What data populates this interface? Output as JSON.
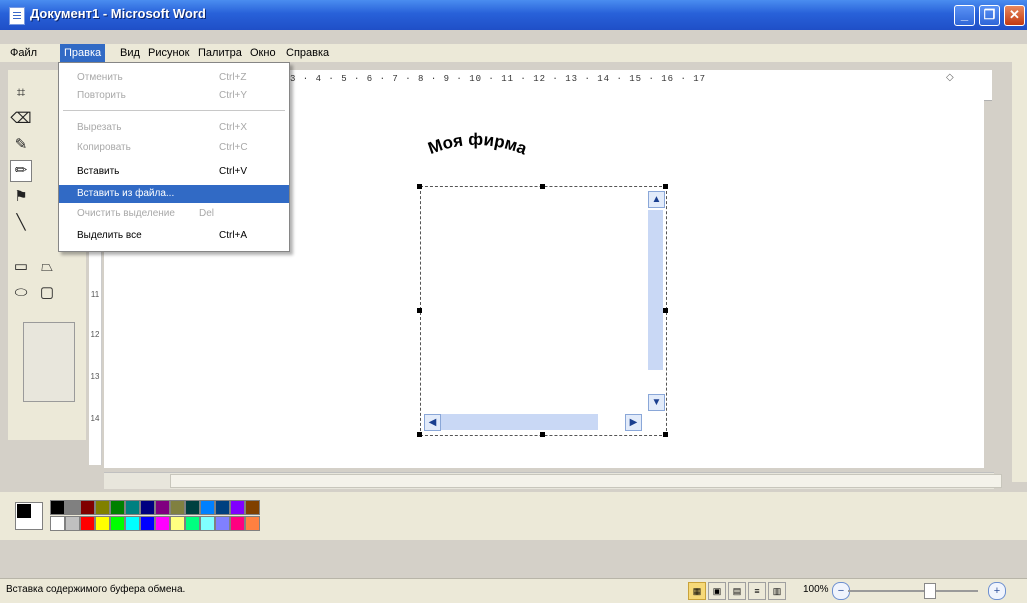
{
  "window": {
    "title": "Документ1 - Microsoft Word",
    "minimize_glyph": "_",
    "restore_glyph": "❐",
    "close_glyph": "✕"
  },
  "menubar": {
    "items": [
      "Файл",
      "Правка",
      "Вид",
      "Рисунок",
      "Палитра",
      "Окно",
      "Справка"
    ],
    "active": "Правка"
  },
  "edit_menu": {
    "items": [
      {
        "label": "Отменить",
        "shortcut": "Ctrl+Z",
        "enabled": false
      },
      {
        "label": "Повторить",
        "shortcut": "Ctrl+Y",
        "enabled": false
      },
      {
        "label": "Вырезать",
        "shortcut": "Ctrl+X",
        "enabled": false
      },
      {
        "label": "Копировать",
        "shortcut": "Ctrl+C",
        "enabled": false
      },
      {
        "label": "Вставить",
        "shortcut": "Ctrl+V",
        "enabled": true
      },
      {
        "label": "Вставить из файла...",
        "shortcut": "",
        "enabled": true,
        "highlighted": true
      },
      {
        "label": "Очистить выделение",
        "shortcut": "Del",
        "enabled": false
      },
      {
        "label": "Выделить все",
        "shortcut": "Ctrl+A",
        "enabled": true
      }
    ]
  },
  "ruler": {
    "numbers": "3 · 4 · 5 · 6 · 7 · 8 · 9 · 10 · 11 · 12 · 13 · 14 · 15 · 16 · 17"
  },
  "vertical_ruler": {
    "numbers": [
      "11",
      "12",
      "13",
      "14"
    ]
  },
  "canvas": {
    "wordart_text": "Моя фирма"
  },
  "palette": {
    "row1": [
      "#000000",
      "#808080",
      "#800000",
      "#808000",
      "#008000",
      "#008080",
      "#000080",
      "#800080",
      "#808040",
      "#004040",
      "#0080ff",
      "#004080",
      "#8000ff",
      "#804000"
    ],
    "row2": [
      "#ffffff",
      "#c0c0c0",
      "#ff0000",
      "#ffff00",
      "#00ff00",
      "#00ffff",
      "#0000ff",
      "#ff00ff",
      "#ffff80",
      "#00ff80",
      "#80ffff",
      "#8080ff",
      "#ff0080",
      "#ff8040"
    ]
  },
  "statusbar": {
    "text": "Вставка содержимого буфера обмена.",
    "zoom": "100%",
    "zoom_out": "−",
    "zoom_in": "+"
  }
}
